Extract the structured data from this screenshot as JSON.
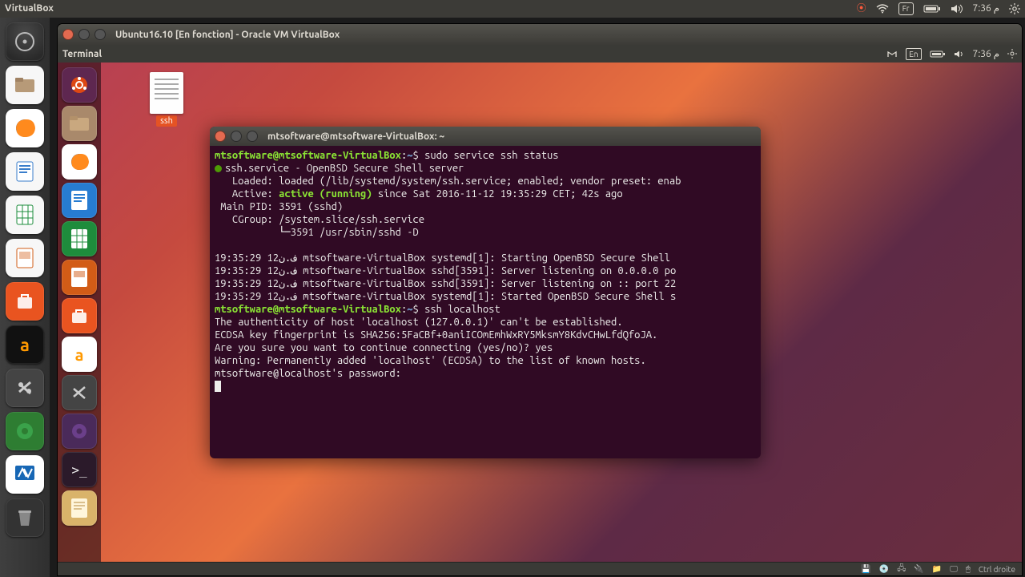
{
  "host": {
    "app_title": "VirtualBox",
    "tray": {
      "lang": "Fr",
      "time": "7:36 م"
    }
  },
  "vm": {
    "title": "Ubuntu16.10 [En fonction] - Oracle VM VirtualBox",
    "menubar_left": "Terminal",
    "guest_tray": {
      "lang": "En",
      "time": "7:36 م"
    },
    "status_right": "Ctrl droite"
  },
  "desktop": {
    "file_label": "ssh"
  },
  "terminal": {
    "title": "mtsoftware@mtsoftware-VirtualBox: ~",
    "prompt_user": "mtsoftware@mtsoftware-VirtualBox",
    "prompt_sep": ":",
    "prompt_path": "~",
    "prompt_dollar": "$ ",
    "cmd1": "sudo service ssh status",
    "svc_line": "ssh.service - OpenBSD Secure Shell server",
    "loaded_line": "   Loaded: loaded (/lib/systemd/system/ssh.service; enabled; vendor preset: enab",
    "active_label": "   Active: ",
    "active_state": "active (running)",
    "active_rest": " since Sat 2016-11-12 19:35:29 CET; 42s ago",
    "pid_line": " Main PID: 3591 (sshd)",
    "cgroup_line": "   CGroup: /system.slice/ssh.service",
    "cgroup_sub": "           └─3591 /usr/sbin/sshd -D",
    "log1": "ف.ن12 19:35:29 mtsoftware-VirtualBox systemd[1]: Starting OpenBSD Secure Shell ",
    "log2": "ف.ن12 19:35:29 mtsoftware-VirtualBox sshd[3591]: Server listening on 0.0.0.0 po",
    "log3": "ف.ن12 19:35:29 mtsoftware-VirtualBox sshd[3591]: Server listening on :: port 22",
    "log4": "ف.ن12 19:35:29 mtsoftware-VirtualBox systemd[1]: Started OpenBSD Secure Shell s",
    "cmd2": "ssh localhost",
    "auth1": "The authenticity of host 'localhost (127.0.0.1)' can't be established.",
    "auth2": "ECDSA key fingerprint is SHA256:5FaCBf+0aniICOmEmhWxRY5MksmY8KdvCHwLfdQfoJA.",
    "auth3": "Are you sure you want to continue connecting (yes/no)? yes",
    "auth4": "Warning: Permanently added 'localhost' (ECDSA) to the list of known hosts.",
    "pw_prompt": "mtsoftware@localhost's password:"
  }
}
